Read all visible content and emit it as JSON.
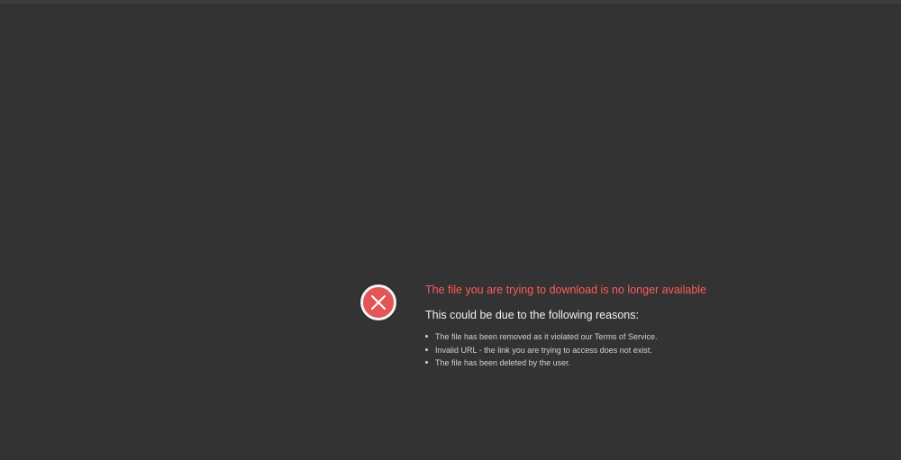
{
  "error": {
    "title": "The file you are trying to download is no longer available",
    "reasons_heading": "This could be due to the following reasons:",
    "reasons": [
      "The file has been removed as it violated our Terms of Service.",
      "Invalid URL - the link you are trying to access does not exist.",
      "The file has been deleted by the user."
    ],
    "icon": "error-x-circle-icon"
  },
  "colors": {
    "background": "#333333",
    "error_red": "#ff5a5a",
    "icon_fill": "#e35656",
    "heading_text": "#f0f0f0",
    "list_text": "#d2d2d2"
  }
}
